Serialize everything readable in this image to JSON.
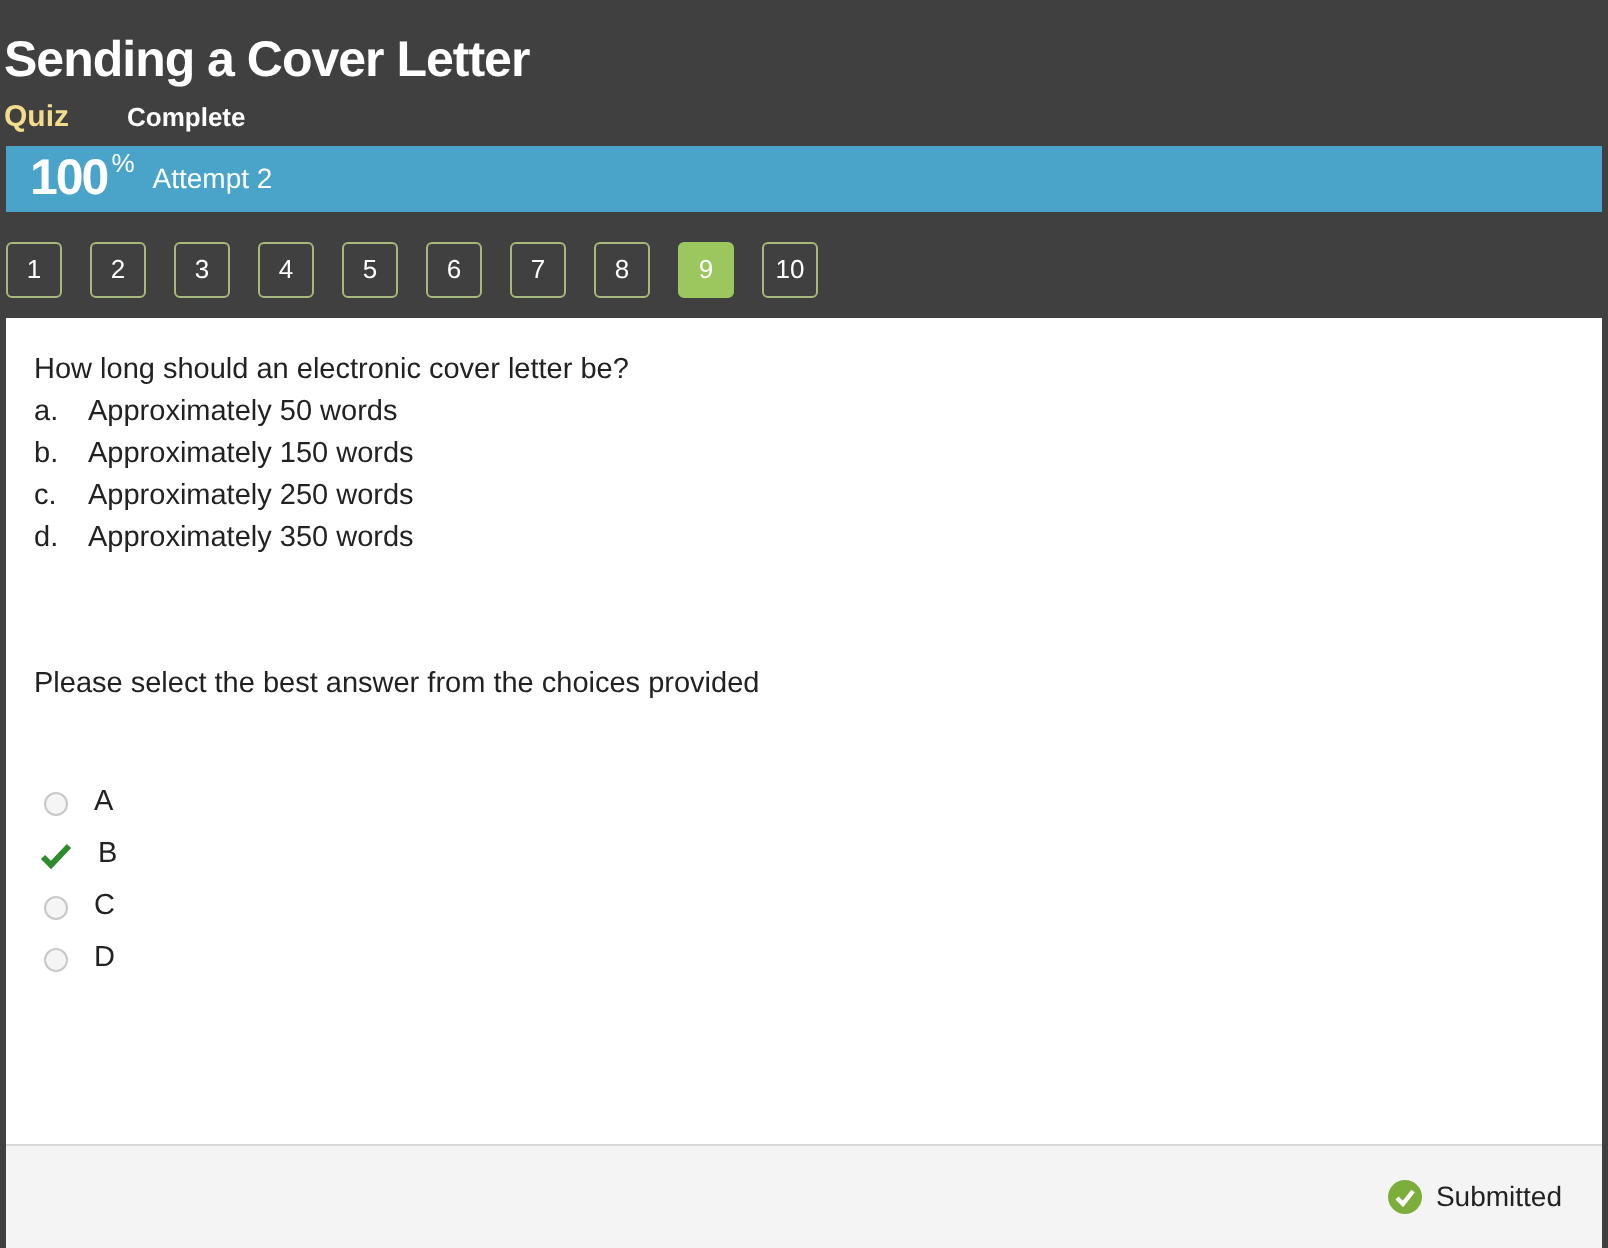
{
  "title": "Sending a Cover Letter",
  "subtitle": {
    "type": "Quiz",
    "status": "Complete"
  },
  "score_bar": {
    "score": "100$^{%}$",
    "attempt": "Attempt 2"
  },
  "question_nav": [
    {
      "label": "1",
      "selected": false
    },
    {
      "label": "2",
      "selected": false
    },
    {
      "label": "3",
      "selected": false
    },
    {
      "label": "4",
      "selected": false
    },
    {
      "label": "5",
      "selected": false
    },
    {
      "label": "6",
      "selected": false
    },
    {
      "label": "7",
      "selected": false
    },
    {
      "label": "8",
      "selected": false
    },
    {
      "label": "9",
      "selected": true
    },
    {
      "label": "10",
      "selected": false
    }
  ],
  "question": {
    "text": "How long should an electronic cover letter be?",
    "choices": [
      {
        "letter": "a.",
        "text": "Approximately 50 words"
      },
      {
        "letter": "b.",
        "text": "Approximately 150 words"
      },
      {
        "letter": "c.",
        "text": "Approximately 250 words"
      },
      {
        "letter": "d.",
        "text": "Approximately 350 words"
      }
    ]
  },
  "instruction": "Please select the best answer from the choices provided",
  "answers": [
    {
      "label": "A",
      "selected": false
    },
    {
      "label": "B",
      "selected": true
    },
    {
      "label": "C",
      "selected": false
    },
    {
      "label": "D",
      "selected": false
    }
  ],
  "footer": {
    "status": "Submitted"
  }
}
